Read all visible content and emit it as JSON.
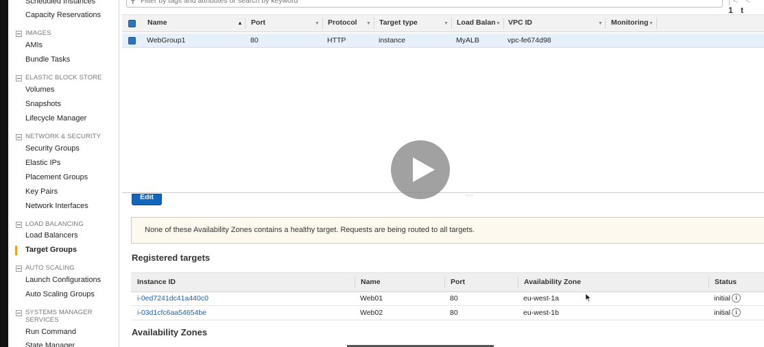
{
  "sidebar": {
    "items": [
      {
        "label": "Scheduled Instances",
        "type": "item"
      },
      {
        "label": "Capacity Reservations",
        "type": "item"
      },
      {
        "label": "IMAGES",
        "type": "section"
      },
      {
        "label": "AMIs",
        "type": "item"
      },
      {
        "label": "Bundle Tasks",
        "type": "item"
      },
      {
        "label": "ELASTIC BLOCK STORE",
        "type": "section"
      },
      {
        "label": "Volumes",
        "type": "item"
      },
      {
        "label": "Snapshots",
        "type": "item"
      },
      {
        "label": "Lifecycle Manager",
        "type": "item"
      },
      {
        "label": "NETWORK & SECURITY",
        "type": "section"
      },
      {
        "label": "Security Groups",
        "type": "item"
      },
      {
        "label": "Elastic IPs",
        "type": "item"
      },
      {
        "label": "Placement Groups",
        "type": "item"
      },
      {
        "label": "Key Pairs",
        "type": "item"
      },
      {
        "label": "Network Interfaces",
        "type": "item"
      },
      {
        "label": "LOAD BALANCING",
        "type": "section"
      },
      {
        "label": "Load Balancers",
        "type": "item"
      },
      {
        "label": "Target Groups",
        "type": "item",
        "active": true
      },
      {
        "label": "AUTO SCALING",
        "type": "section"
      },
      {
        "label": "Launch Configurations",
        "type": "item"
      },
      {
        "label": "Auto Scaling Groups",
        "type": "item"
      },
      {
        "label": "SYSTEMS MANAGER SERVICES",
        "type": "section"
      },
      {
        "label": "Run Command",
        "type": "item"
      },
      {
        "label": "State Manager",
        "type": "item"
      }
    ]
  },
  "search": {
    "placeholder": "Filter by tags and attributes or search by keyword"
  },
  "pager": {
    "nav": "|< <",
    "label": "1 t"
  },
  "target_groups": {
    "columns": [
      "Name",
      "Port",
      "Protocol",
      "Target type",
      "Load Balancer",
      "VPC ID",
      "Monitoring"
    ],
    "rows": [
      {
        "name": "WebGroup1",
        "port": "80",
        "protocol": "HTTP",
        "target_type": "instance",
        "load_balancer": "MyALB",
        "vpc_id": "vpc-fe674d98",
        "monitoring": ""
      }
    ]
  },
  "edit_label": "Edit",
  "warning_text": "None of these Availability Zones contains a healthy target. Requests are being routed to all targets.",
  "registered_title": "Registered targets",
  "registered_targets": {
    "columns": [
      "Instance ID",
      "Name",
      "Port",
      "Availability Zone",
      "Status"
    ],
    "rows": [
      {
        "instance_id": "i-0ed7241dc41a440c0",
        "name": "Web01",
        "port": "80",
        "az": "eu-west-1a",
        "status": "initial"
      },
      {
        "instance_id": "i-03d1cfc6aa54654be",
        "name": "Web02",
        "port": "80",
        "az": "eu-west-1b",
        "status": "initial"
      }
    ]
  },
  "az_title": "Availability Zones",
  "colors": {
    "accent": "#1166bb",
    "active_bar": "#f59b1c",
    "link": "#1c5fa8",
    "warning_border": "#e3c896"
  },
  "icons": {
    "search": "magnifier-icon",
    "info": "info-icon",
    "play": "play-icon"
  }
}
